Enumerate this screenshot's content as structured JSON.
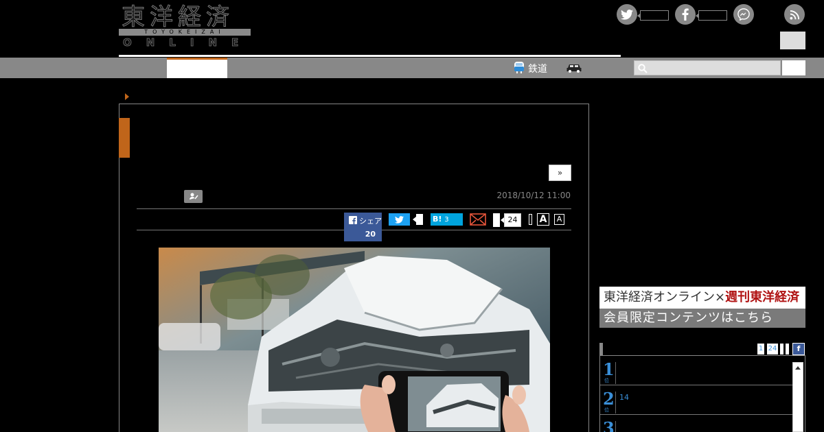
{
  "header": {
    "logo": {
      "kanji": "東洋経済",
      "romaji": "TOYOKEIZAI",
      "online": "ONLINE"
    },
    "social_icons": [
      "twitter-icon",
      "facebook-icon",
      "messenger-icon",
      "rss-icon"
    ]
  },
  "nav": {
    "rail_label": "鉄道",
    "icons": [
      "train-icon",
      "car-icon"
    ],
    "search_placeholder": ""
  },
  "article": {
    "next_label": "»",
    "date": "2018/10/12 11:00",
    "share": {
      "facebook_label": "シェア",
      "facebook_count": "20",
      "hatena_label": "B!",
      "hatena_count": "3",
      "comment_count": "24",
      "font_large": "A",
      "font_small": "A"
    },
    "image_description_icon": "damaged-car-photo"
  },
  "sidebar": {
    "promo": {
      "line1": "東洋経済オンライン×",
      "line1_magazine": "週刊東洋経済",
      "line2": "会員限定コンテンツはこちら"
    },
    "ranking": {
      "tabs": [
        "1",
        "24"
      ],
      "facebook_tab": "f",
      "rows": [
        {
          "rank": "1",
          "unit": "位",
          "text": ""
        },
        {
          "rank": "2",
          "unit": "位",
          "text": "14"
        },
        {
          "rank": "3",
          "unit": "位",
          "text": ""
        }
      ]
    }
  },
  "colors": {
    "accent": "#c0651a",
    "nav_bg": "#888888",
    "facebook": "#3b5998",
    "twitter": "#1da1f2",
    "hatena": "#00a4de",
    "rank_blue": "#3a8fd8"
  }
}
